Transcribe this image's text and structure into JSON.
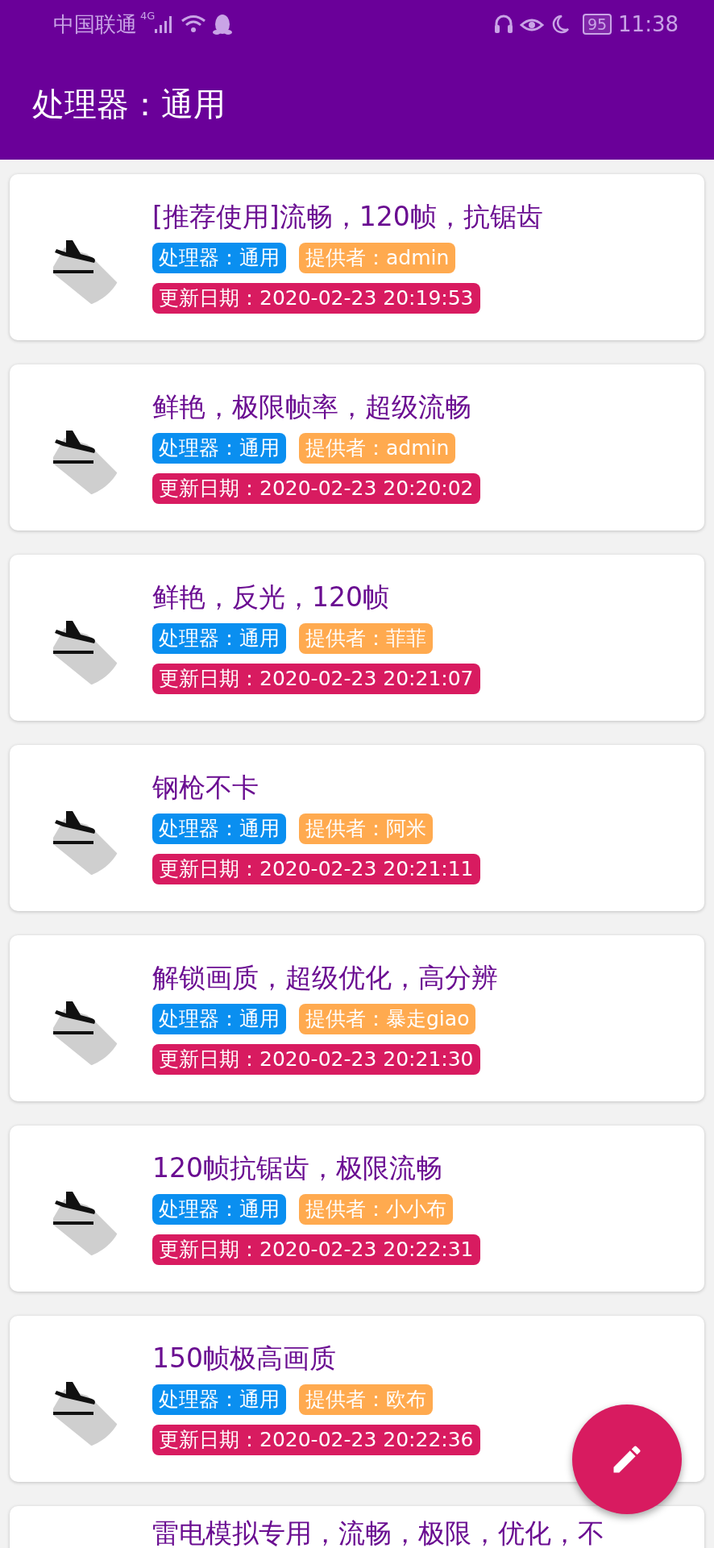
{
  "status_bar": {
    "carrier": "中国联通",
    "network": "4G",
    "battery": "95",
    "time": "11:38"
  },
  "app_bar": {
    "title": "处理器：通用"
  },
  "items": [
    {
      "title": "[推荐使用]流畅，120帧，抗锯齿",
      "processor": "处理器：通用",
      "provider": "提供者：admin",
      "date": "更新日期：2020-02-23 20:19:53"
    },
    {
      "title": "鲜艳，极限帧率，超级流畅",
      "processor": "处理器：通用",
      "provider": "提供者：admin",
      "date": "更新日期：2020-02-23 20:20:02"
    },
    {
      "title": "鲜艳，反光，120帧",
      "processor": "处理器：通用",
      "provider": "提供者：菲菲",
      "date": "更新日期：2020-02-23 20:21:07"
    },
    {
      "title": "钢枪不卡",
      "processor": "处理器：通用",
      "provider": "提供者：阿米",
      "date": "更新日期：2020-02-23 20:21:11"
    },
    {
      "title": "解锁画质，超级优化，高分辨",
      "processor": "处理器：通用",
      "provider": "提供者：暴走giao",
      "date": "更新日期：2020-02-23 20:21:30"
    },
    {
      "title": "120帧抗锯齿，极限流畅",
      "processor": "处理器：通用",
      "provider": "提供者：小小布",
      "date": "更新日期：2020-02-23 20:22:31"
    },
    {
      "title": "150帧极高画质",
      "processor": "处理器：通用",
      "provider": "提供者：欧布",
      "date": "更新日期：2020-02-23 20:22:36"
    },
    {
      "title": "雷电模拟专用，流畅，极限，优化，不"
    }
  ]
}
